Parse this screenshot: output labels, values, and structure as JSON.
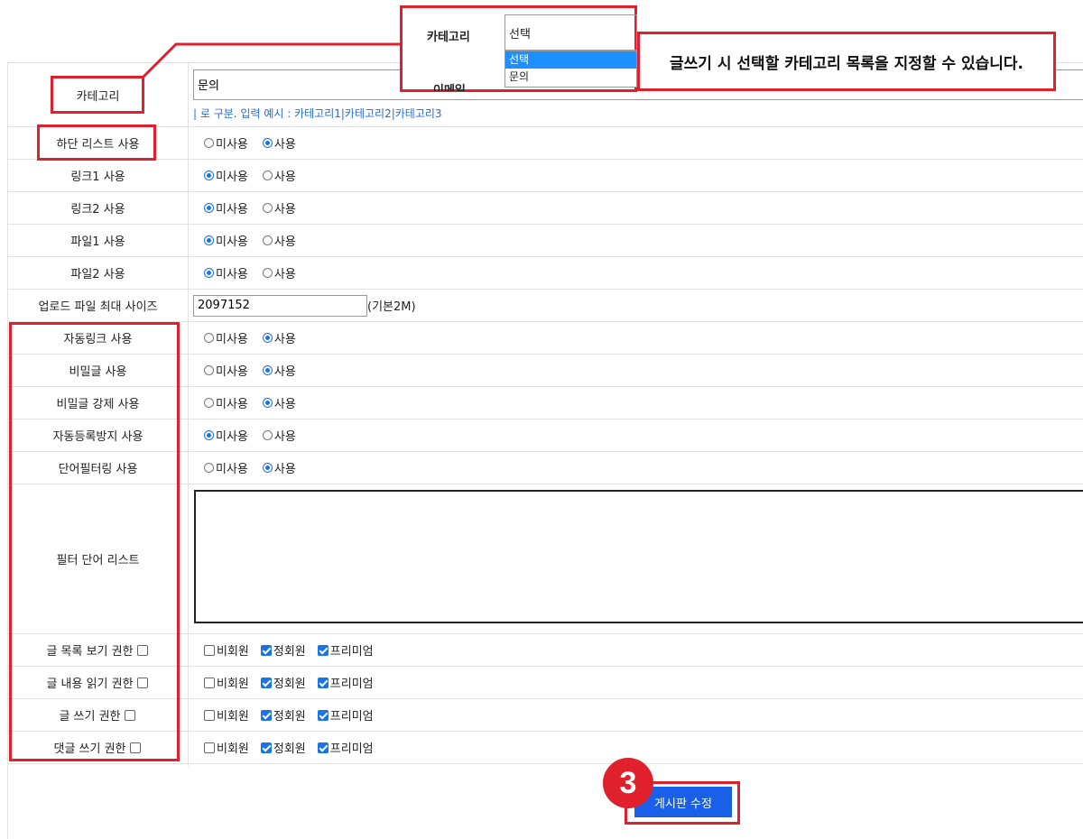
{
  "category": {
    "label": "카테고리",
    "value": "문의",
    "hint": "| 로 구분. 입력 예시 : 카테고리1|카테고리2|카테고리3"
  },
  "popup": {
    "label1": "카테고리",
    "label2": "이메일",
    "select_value": "선택",
    "options": [
      "선택",
      "문의"
    ]
  },
  "callout": "글쓰기 시 선택할 카테고리 목록을 지정할 수 있습니다.",
  "radio_labels": {
    "off": "미사용",
    "on": "사용"
  },
  "rows": [
    {
      "label": "하단 리스트 사용",
      "selected": "사용"
    },
    {
      "label": "링크1 사용",
      "selected": "미사용"
    },
    {
      "label": "링크2 사용",
      "selected": "미사용"
    },
    {
      "label": "파일1 사용",
      "selected": "미사용"
    },
    {
      "label": "파일2 사용",
      "selected": "미사용"
    }
  ],
  "upload": {
    "label": "업로드 파일 최대 사이즈",
    "value": "2097152",
    "suffix": "(기본2M)"
  },
  "rows2": [
    {
      "label": "자동링크 사용",
      "selected": "사용"
    },
    {
      "label": "비밀글 사용",
      "selected": "사용"
    },
    {
      "label": "비밀글 강제 사용",
      "selected": "사용"
    },
    {
      "label": "자동등록방지 사용",
      "selected": "미사용"
    },
    {
      "label": "단어필터링 사용",
      "selected": "사용"
    }
  ],
  "filter": {
    "label": "필터 단어 리스트",
    "value": ""
  },
  "perm_options": [
    "비회원",
    "정회원",
    "프리미엄"
  ],
  "permissions": [
    {
      "label": "글 목록 보기 권한",
      "checked": [
        false,
        true,
        true
      ]
    },
    {
      "label": "글 내용 읽기 권한",
      "checked": [
        false,
        true,
        true
      ]
    },
    {
      "label": "글 쓰기 권한",
      "checked": [
        false,
        true,
        true
      ]
    },
    {
      "label": "댓글 쓰기 권한",
      "checked": [
        false,
        true,
        true
      ]
    }
  ],
  "submit_label": "게시판 수정",
  "step_number": "3",
  "colors": {
    "highlight": "#e0202c",
    "primary": "#1a5fe8",
    "hint": "#2a6bd1"
  }
}
